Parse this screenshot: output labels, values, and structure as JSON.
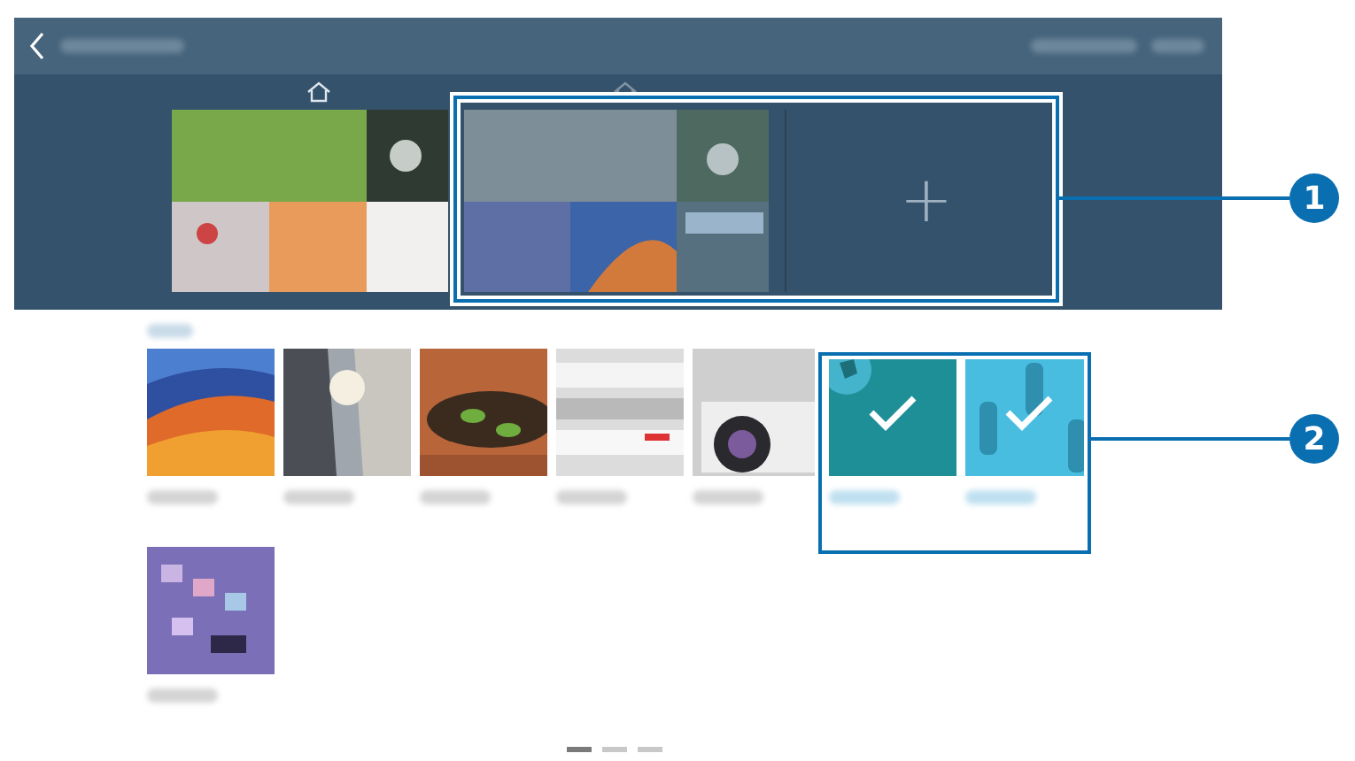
{
  "home_pages": [
    {
      "kind": "page",
      "home": true
    },
    {
      "kind": "page",
      "home": false
    },
    {
      "kind": "add",
      "label": "+"
    }
  ],
  "tiles": [
    {
      "selected": false
    },
    {
      "selected": false
    },
    {
      "selected": false
    },
    {
      "selected": false
    },
    {
      "selected": false
    },
    {
      "selected": true
    },
    {
      "selected": true
    },
    {
      "selected": false
    }
  ],
  "page_indicator": [
    {
      "selected": true
    },
    {
      "selected": false
    },
    {
      "selected": false
    }
  ],
  "callouts": [
    {
      "number": "1"
    },
    {
      "number": "2"
    }
  ]
}
